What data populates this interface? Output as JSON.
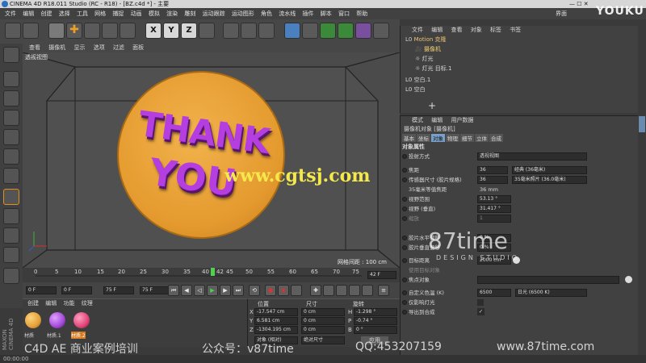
{
  "window": {
    "title": "CINEMA 4D R18.011 Studio (RC - R18) - [BZ.c4d *] - 主要",
    "layout_label": "界面",
    "layout_value": "启动"
  },
  "menubar": [
    "文件",
    "编辑",
    "创建",
    "选择",
    "工具",
    "网格",
    "捕捉",
    "动画",
    "模拟",
    "渲染",
    "雕刻",
    "运动跟踪",
    "运动图形",
    "角色",
    "流水线",
    "插件",
    "脚本",
    "窗口",
    "帮助"
  ],
  "viewport": {
    "menu": [
      "查看",
      "摄像机",
      "显示",
      "选项",
      "过滤",
      "面板"
    ],
    "label": "透视视图",
    "grid_label": "网格间距 : 100 cm",
    "text_line1": "THANK",
    "text_line2": "YOU",
    "watermark": "www.cgtsj.com"
  },
  "timeline": {
    "ticks": [
      "0",
      "5",
      "10",
      "15",
      "20",
      "25",
      "30",
      "35",
      "40",
      "42",
      "45",
      "50",
      "55",
      "60",
      "65",
      "70",
      "75"
    ],
    "current_frame": "42 F",
    "start_frame": "0 F",
    "end_frame": "75 F",
    "start_field": "0 F",
    "end_field": "75 F"
  },
  "material_panel": {
    "menu": [
      "创建",
      "编辑",
      "功能",
      "纹理"
    ],
    "materials": [
      {
        "name": "材质",
        "color": "#e3a13a"
      },
      {
        "name": "材质.1",
        "color": "#a24ad8"
      },
      {
        "name": "材质.2",
        "color": "#e0457a"
      }
    ]
  },
  "coords_panel": {
    "headers": [
      "位置",
      "尺寸",
      "旋转"
    ],
    "rows": [
      {
        "axis": "X",
        "pos": "-17.547 cm",
        "size": "0 cm",
        "rot_axis": "H",
        "rot": "-1.298 °"
      },
      {
        "axis": "Y",
        "pos": "6.581 cm",
        "size": "0 cm",
        "rot_axis": "P",
        "rot": "-0.74 °"
      },
      {
        "axis": "Z",
        "pos": "-1304.195 cm",
        "size": "0 cm",
        "rot_axis": "B",
        "rot": "0 °"
      }
    ],
    "mode_select": "对象 (相对)",
    "size_select": "绝对尺寸",
    "apply_label": "应用"
  },
  "object_manager": {
    "menu": [
      "文件",
      "编辑",
      "查看",
      "对象",
      "标签",
      "书签"
    ],
    "rows": [
      {
        "name": "Motion 克隆",
        "indent": 0
      },
      {
        "name": "摄像机",
        "indent": 1
      },
      {
        "name": "灯光",
        "indent": 1
      },
      {
        "name": "灯光 目标.1",
        "indent": 1
      },
      {
        "name": "空白.1",
        "indent": 0
      },
      {
        "name": "空白",
        "indent": 0
      }
    ]
  },
  "attribute_manager": {
    "menu": [
      "模式",
      "编辑",
      "用户数据"
    ],
    "object_title": "摄像机对象 [摄像机]",
    "tabs": [
      "基本",
      "坐标",
      "对象",
      "物理",
      "细节",
      "立体",
      "合成"
    ],
    "active_tab": "对象",
    "section": "对象属性",
    "fields": [
      {
        "label": "投射方式",
        "value": "透视视图"
      },
      {
        "label": "焦距",
        "value": "36",
        "extra": "经典 (36毫米)"
      },
      {
        "label": "传感器尺寸 (胶片规格)",
        "value": "36",
        "extra": "35毫米照片 (36.0毫米)"
      },
      {
        "label": "35毫米等值焦距",
        "value": "36 mm"
      },
      {
        "label": "视野范围",
        "value": "53.13 °"
      },
      {
        "label": "视野 (垂直)",
        "value": "31.417 °"
      },
      {
        "label": "缩放",
        "value": "1"
      },
      {
        "label": "胶片水平偏移",
        "value": "0 %"
      },
      {
        "label": "胶片垂直偏移",
        "value": "0 %"
      },
      {
        "label": "目标距离",
        "value": "2000 cm"
      },
      {
        "label": "使用目标对象",
        "value": ""
      },
      {
        "label": "焦点对象",
        "value": ""
      },
      {
        "label": "自定义色温 (K)",
        "value": "6500",
        "extra": "日光 (6500 K)"
      },
      {
        "label": "仅影响灯光",
        "value": ""
      },
      {
        "label": "导出到合成",
        "value": "✓"
      }
    ]
  },
  "overlays": {
    "brand": "87time",
    "brand_sub": "DESIGN STUDIO",
    "youku": "YOUKU",
    "footer": [
      "C4D AE 商业案例培训",
      "公众号：v87time",
      "QQ:453207159",
      "www.87time.com"
    ],
    "maxon": "MAXON CINEMA 4D"
  },
  "statusbar": "00:00:00"
}
